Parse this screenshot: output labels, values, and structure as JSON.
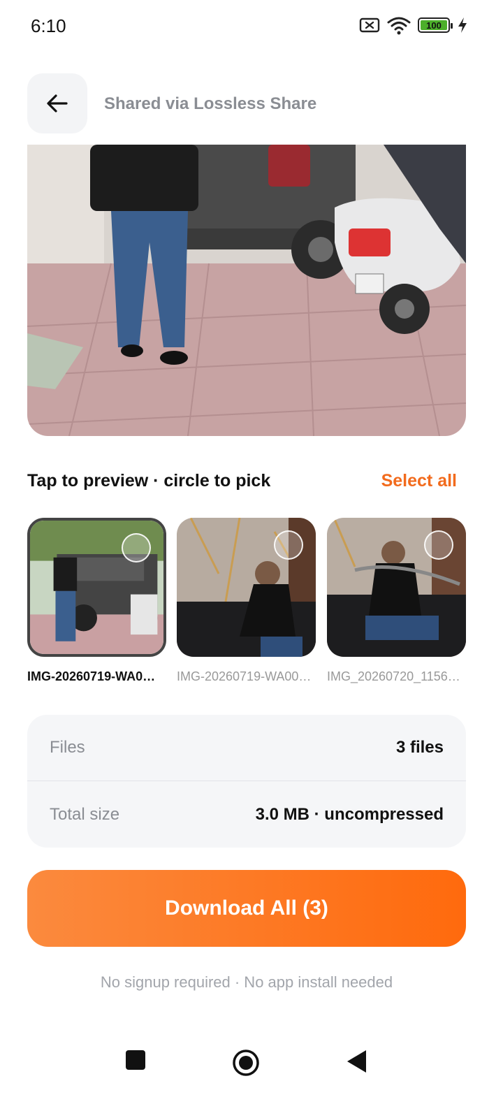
{
  "status_bar": {
    "time": "6:10",
    "battery_level": "100",
    "icons": [
      "sim-off-icon",
      "wifi-icon",
      "battery-icon",
      "charging-bolt-icon"
    ]
  },
  "header": {
    "title": "Shared via Lossless Share",
    "back_icon": "arrow-left-icon"
  },
  "gallery": {
    "instruction": "Tap to preview · circle to pick",
    "select_all_label": "Select all",
    "items": [
      {
        "name": "IMG-20260719-WA0…",
        "active": true
      },
      {
        "name": "IMG-20260719-WA00…",
        "active": false
      },
      {
        "name": "IMG_20260720_1156…",
        "active": false
      }
    ]
  },
  "info": {
    "files_label": "Files",
    "files_value": "3 files",
    "size_label": "Total size",
    "size_value": "3.0 MB · uncompressed"
  },
  "actions": {
    "download_label": "Download All (3)"
  },
  "footer": {
    "note": "No signup required · No app install needed"
  },
  "colors": {
    "accent": "#f26b1d",
    "button_gradient_start": "#fb8a3e",
    "button_gradient_end": "#ff6a0d",
    "card_bg": "#f5f6f8",
    "muted_text": "#8a8d93"
  }
}
